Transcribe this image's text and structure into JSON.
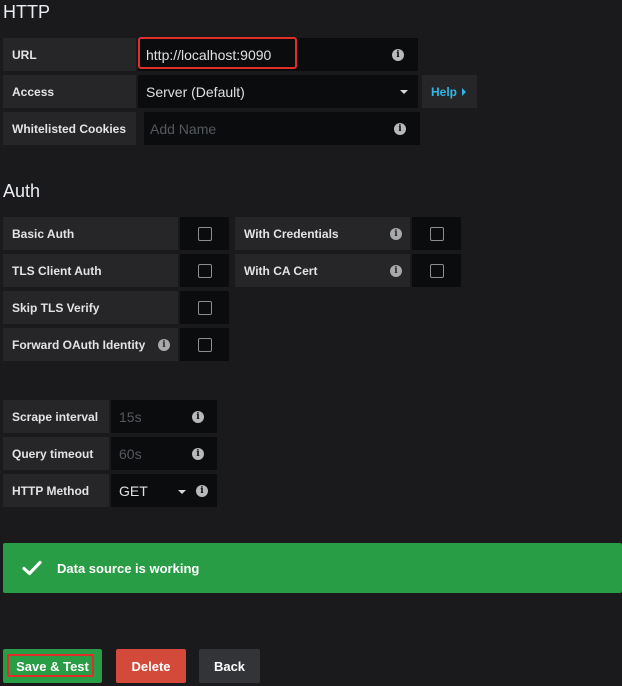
{
  "http": {
    "title": "HTTP",
    "url_label": "URL",
    "url_value": "http://localhost:9090",
    "access_label": "Access",
    "access_value": "Server (Default)",
    "help_label": "Help",
    "cookies_label": "Whitelisted Cookies",
    "cookies_placeholder": "Add Name"
  },
  "auth": {
    "title": "Auth",
    "basic_auth": "Basic Auth",
    "with_credentials": "With Credentials",
    "tls_client_auth": "TLS Client Auth",
    "with_ca_cert": "With CA Cert",
    "skip_tls_verify": "Skip TLS Verify",
    "forward_oauth": "Forward OAuth Identity",
    "checkboxes": {
      "basic_auth": false,
      "with_credentials": false,
      "tls_client_auth": false,
      "with_ca_cert": false,
      "skip_tls_verify": false,
      "forward_oauth": false
    }
  },
  "prometheus": {
    "scrape_label": "Scrape interval",
    "scrape_placeholder": "15s",
    "timeout_label": "Query timeout",
    "timeout_placeholder": "60s",
    "method_label": "HTTP Method",
    "method_value": "GET"
  },
  "alert": {
    "message": "Data source is working",
    "color": "#299c46"
  },
  "buttons": {
    "save_test": "Save & Test",
    "delete": "Delete",
    "back": "Back"
  },
  "colors": {
    "highlight_box": "#e02f28",
    "help_link": "#33b5e5",
    "delete": "#d44a3a",
    "back": "#333438",
    "save": "#299c46"
  },
  "icons": {
    "info": "i",
    "check": "check-icon",
    "dropdown": "caret-down-icon",
    "help_caret": "caret-right-icon"
  }
}
